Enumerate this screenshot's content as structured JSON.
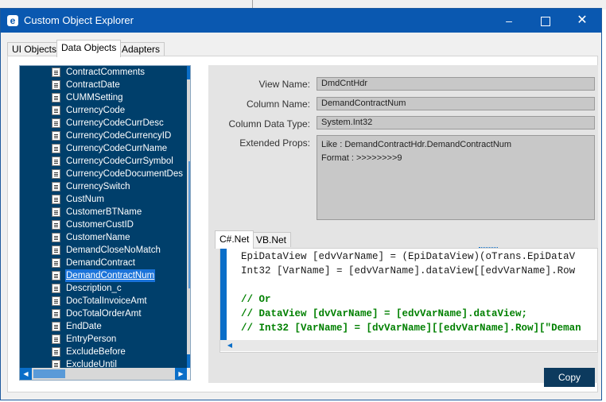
{
  "window": {
    "title": "Custom Object Explorer",
    "app_icon_letter": "e"
  },
  "controls": {
    "minimize": "–",
    "close": "✕"
  },
  "tabs": [
    "UI Objects",
    "Data Objects",
    "Adapters"
  ],
  "active_tab": "Data Objects",
  "fields": {
    "list": [
      "ContractComments",
      "ContractDate",
      "CUMMSetting",
      "CurrencyCode",
      "CurrencyCodeCurrDesc",
      "CurrencyCodeCurrencyID",
      "CurrencyCodeCurrName",
      "CurrencyCodeCurrSymbol",
      "CurrencyCodeDocumentDes",
      "CurrencySwitch",
      "CustNum",
      "CustomerBTName",
      "CustomerCustID",
      "CustomerName",
      "DemandCloseNoMatch",
      "DemandContract",
      "DemandContractNum",
      "Description_c",
      "DocTotalInvoiceAmt",
      "DocTotalOrderAmt",
      "EndDate",
      "EntryPerson",
      "ExcludeBefore",
      "ExcludeUntil"
    ],
    "selected_index": 16
  },
  "details": {
    "view_name_label": "View Name:",
    "view_name": "DmdCntHdr",
    "column_name_label": "Column Name:",
    "column_name": "DemandContractNum",
    "column_type_label": "Column Data Type:",
    "column_type": "System.Int32",
    "extended_props_label": "Extended Props:",
    "extended_props_line1": "Like : DemandContractHdr.DemandContractNum",
    "extended_props_line2": "Format : >>>>>>>>9"
  },
  "code_tabs": [
    "C#.Net",
    "VB.Net"
  ],
  "active_code_tab": "C#.Net",
  "code_lines": [
    {
      "text": "EpiDataView [edvVarName] = (EpiDataView)(oTrans.EpiDataV",
      "comment": false
    },
    {
      "text": "Int32 [VarName] = [edvVarName].dataView[[edvVarName].Row",
      "comment": false
    },
    {
      "text": "",
      "comment": false
    },
    {
      "text": "//  Or",
      "comment": true
    },
    {
      "text": "// DataView [dvVarName] = [edvVarName].dataView;",
      "comment": true
    },
    {
      "text": "// Int32 [VarName] = [dvVarName][[edvVarName].Row][\"Deman",
      "comment": true
    }
  ],
  "copy_button": "Copy"
}
